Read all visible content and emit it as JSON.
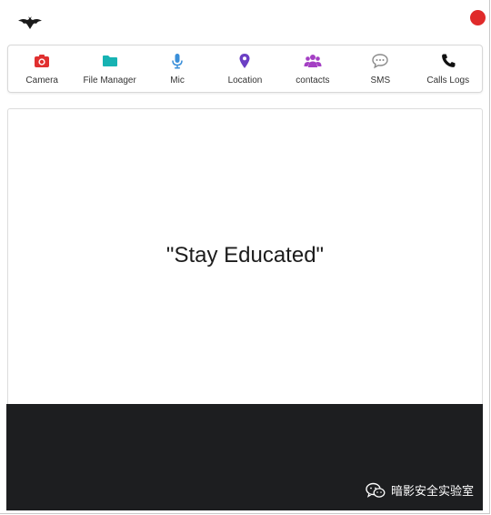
{
  "header": {
    "logo_icon": "bat-icon",
    "close_color": "#e02b2b"
  },
  "toolbar": {
    "items": [
      {
        "label": "Camera",
        "icon": "camera-icon",
        "color": "#e03030"
      },
      {
        "label": "File Manager",
        "icon": "folder-icon",
        "color": "#17b3b3"
      },
      {
        "label": "Mic",
        "icon": "microphone-icon",
        "color": "#3a8fd9"
      },
      {
        "label": "Location",
        "icon": "map-pin-icon",
        "color": "#6b3fc4"
      },
      {
        "label": "contacts",
        "icon": "users-icon",
        "color": "#a43fc4"
      },
      {
        "label": "SMS",
        "icon": "chat-bubble-icon",
        "color": "#8a8a8a"
      },
      {
        "label": "Calls Logs",
        "icon": "phone-icon",
        "color": "#111111"
      }
    ]
  },
  "main": {
    "quote": "\"Stay Educated\""
  },
  "footer": {
    "watermark": "暗影安全实验室",
    "watermark_icon": "wechat-icon"
  }
}
